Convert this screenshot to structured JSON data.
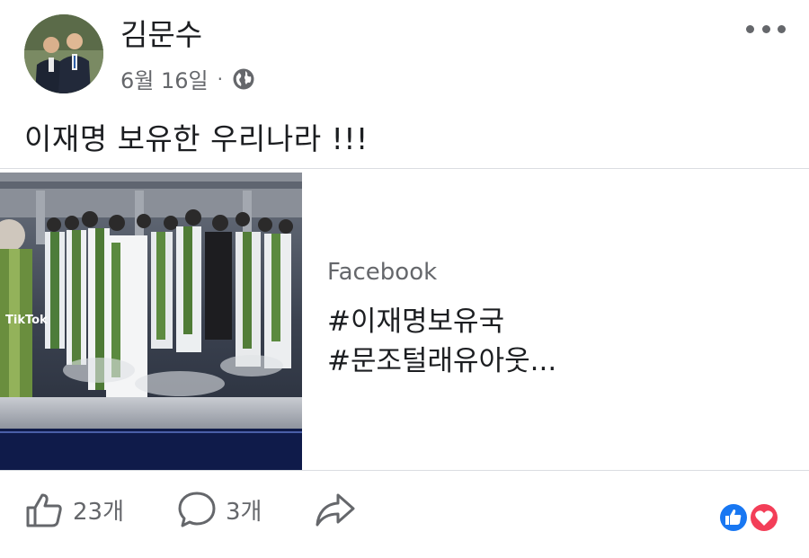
{
  "post": {
    "author": "김문수",
    "date": "6월 16일",
    "separator": "·",
    "text": "이재명 보유한 우리나라 !!!"
  },
  "link_card": {
    "site": "Facebook",
    "title": "#이재명보유국\n#문조털래유아웃..."
  },
  "thumbnail": {
    "watermark": "TikTok"
  },
  "actions": {
    "like_count": "23개",
    "comment_count": "3개"
  },
  "icons": {
    "privacy": "globe-icon",
    "more": "more-options-icon",
    "like": "thumbs-up-icon",
    "comment": "comment-bubble-icon",
    "share": "share-arrow-icon",
    "reaction_like": "like-reaction-icon",
    "reaction_love": "love-reaction-icon"
  },
  "colors": {
    "text_primary": "#1c1e21",
    "text_secondary": "#65676b",
    "like_blue": "#1877f2",
    "love_red": "#f33e58",
    "divider": "#dadde1"
  }
}
